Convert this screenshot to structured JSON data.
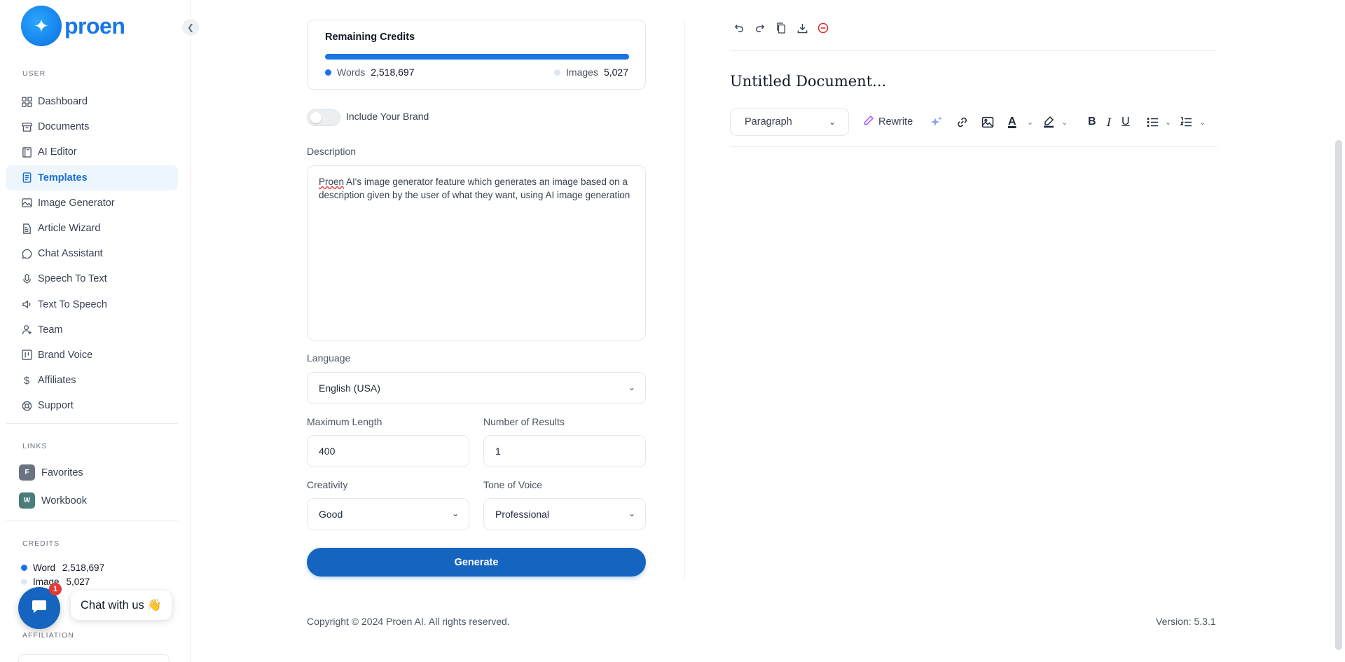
{
  "sidebar": {
    "logo_text": "proen",
    "user_label": "USER",
    "items": [
      {
        "label": "Dashboard",
        "icon": "grid-icon"
      },
      {
        "label": "Documents",
        "icon": "archive-icon"
      },
      {
        "label": "AI Editor",
        "icon": "book-icon"
      },
      {
        "label": "Templates",
        "icon": "file-text-icon",
        "active": true
      },
      {
        "label": "Image Generator",
        "icon": "image-icon"
      },
      {
        "label": "Article Wizard",
        "icon": "file-edit-icon"
      },
      {
        "label": "Chat Assistant",
        "icon": "message-circle-icon"
      },
      {
        "label": "Speech To Text",
        "icon": "microphone-icon"
      },
      {
        "label": "Text To Speech",
        "icon": "speaker-icon"
      },
      {
        "label": "Team",
        "icon": "user-plus-icon"
      },
      {
        "label": "Brand Voice",
        "icon": "layout-icon"
      },
      {
        "label": "Affiliates",
        "icon": "dollar-icon"
      },
      {
        "label": "Support",
        "icon": "lifebuoy-icon"
      }
    ],
    "links_label": "LINKS",
    "links": [
      {
        "badge": "F",
        "label": "Favorites",
        "color": "#6b7280"
      },
      {
        "badge": "W",
        "label": "Workbook",
        "color": "#4a7c79"
      }
    ],
    "credits_label": "CREDITS",
    "credits": {
      "word_label": "Word",
      "word_value": "2,518,697",
      "image_label": "Image",
      "image_value": "5,027"
    },
    "affiliation_label": "AFFILIATION"
  },
  "chat": {
    "badge": "1",
    "text": "Chat with us 👋"
  },
  "credits_card": {
    "title": "Remaining Credits",
    "words_label": "Words",
    "words_value": "2,518,697",
    "images_label": "Images",
    "images_value": "5,027"
  },
  "form": {
    "brand_toggle_label": "Include Your Brand",
    "description_label": "Description",
    "description_spell": "Proen",
    "description_rest": " AI's image generator feature which generates an image based on a description given by the user of what they want, using AI image generation",
    "language_label": "Language",
    "language_value": "English (USA)",
    "max_length_label": "Maximum Length",
    "max_length_value": "400",
    "results_label": "Number of Results",
    "results_value": "1",
    "creativity_label": "Creativity",
    "creativity_value": "Good",
    "tone_label": "Tone of Voice",
    "tone_value": "Professional",
    "generate_label": "Generate"
  },
  "editor": {
    "title": "Untitled Document...",
    "paragraph_value": "Paragraph",
    "rewrite_label": "Rewrite"
  },
  "footer": {
    "copyright": "Copyright © 2024 Proen AI. All rights reserved.",
    "version": "Version: 5.3.1"
  },
  "colors": {
    "accent": "#1565c0",
    "brand": "#1677e8",
    "active_bg": "#eef6fd"
  }
}
